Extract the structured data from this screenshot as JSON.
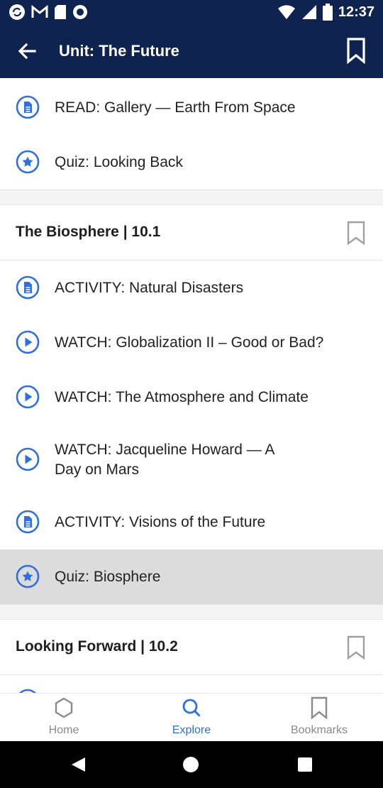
{
  "status_bar": {
    "time": "12:37"
  },
  "app_bar": {
    "title": "Unit: The Future"
  },
  "items_top": [
    {
      "label": "READ: Gallery — Earth From Space",
      "icon": "document-icon"
    },
    {
      "label": "Quiz: Looking Back",
      "icon": "star-icon"
    }
  ],
  "sections": [
    {
      "title": "The Biosphere | 10.1",
      "items": [
        {
          "label": "ACTIVITY: Natural Disasters",
          "icon": "document-icon"
        },
        {
          "label": "WATCH: Globalization II – Good or Bad?",
          "icon": "play-icon"
        },
        {
          "label": "WATCH: The Atmosphere and Climate",
          "icon": "play-icon"
        },
        {
          "label_line1": "WATCH: Jacqueline Howard — A",
          "label_line2": "Day on Mars",
          "icon": "play-icon"
        },
        {
          "label": "ACTIVITY: Visions of the Future",
          "icon": "document-icon"
        },
        {
          "label": "Quiz: Biosphere",
          "icon": "star-icon",
          "selected": true
        }
      ]
    },
    {
      "title": "Looking Forward | 10.2",
      "items": []
    }
  ],
  "tab_bar": {
    "tabs": [
      {
        "label": "Home",
        "icon": "hexagon-home-icon"
      },
      {
        "label": "Explore",
        "icon": "search-icon",
        "active": true
      },
      {
        "label": "Bookmarks",
        "icon": "bookmark-icon"
      }
    ]
  },
  "colors": {
    "primary": "#0f2350",
    "accent": "#2f6fdf",
    "selected_row": "#dcdcdd"
  }
}
